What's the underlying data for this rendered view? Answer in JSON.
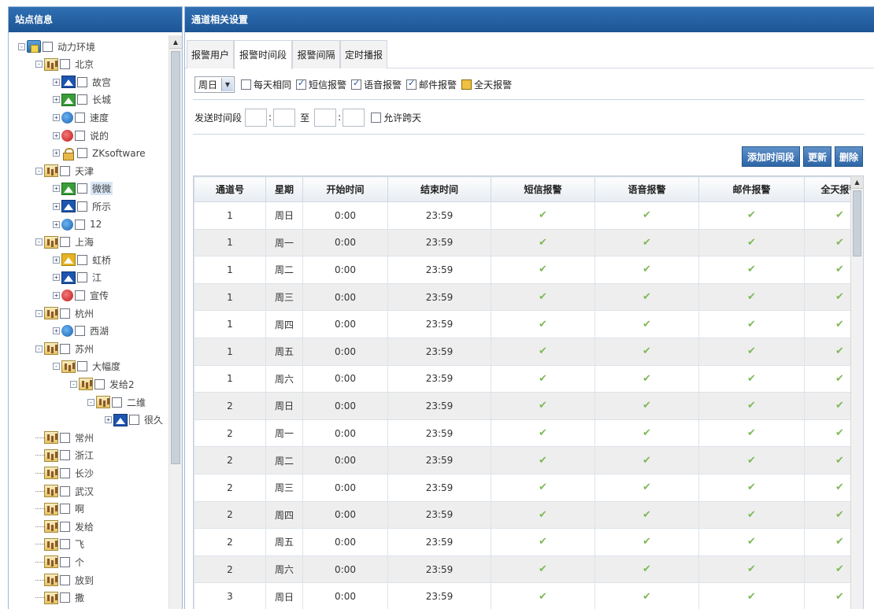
{
  "left_panel": {
    "title": "站点信息",
    "tree": [
      {
        "label": "动力环境",
        "icon": "house-icon",
        "type": "root"
      },
      {
        "label": "北京",
        "icon": "building-icon"
      },
      {
        "label": "故宫",
        "icon": "camera-blue-icon"
      },
      {
        "label": "长城",
        "icon": "camera-green-icon"
      },
      {
        "label": "速度",
        "icon": "circle-blue-icon"
      },
      {
        "label": "说的",
        "icon": "circle-red-icon"
      },
      {
        "label": "ZKsoftware",
        "icon": "lock-icon"
      },
      {
        "label": "天津",
        "icon": "building-icon"
      },
      {
        "label": "微微",
        "icon": "camera-green-icon",
        "selected": true
      },
      {
        "label": "所示",
        "icon": "camera-blue-icon"
      },
      {
        "label": "12",
        "icon": "circle-blue-icon"
      },
      {
        "label": "上海",
        "icon": "building-icon"
      },
      {
        "label": "虹桥",
        "icon": "camera-yellow-icon"
      },
      {
        "label": "江",
        "icon": "camera-blue-icon"
      },
      {
        "label": "宣传",
        "icon": "circle-red-icon"
      },
      {
        "label": "杭州",
        "icon": "building-icon"
      },
      {
        "label": "西湖",
        "icon": "circle-blue-icon"
      },
      {
        "label": "苏州",
        "icon": "building-icon"
      },
      {
        "label": "大幅度",
        "icon": "building-icon"
      },
      {
        "label": "发给2",
        "icon": "building-icon"
      },
      {
        "label": "二维",
        "icon": "building-icon"
      },
      {
        "label": "很久",
        "icon": "camera-blue-icon"
      },
      {
        "label": "常州",
        "icon": "building-icon"
      },
      {
        "label": "浙江",
        "icon": "building-icon"
      },
      {
        "label": "长沙",
        "icon": "building-icon"
      },
      {
        "label": "武汉",
        "icon": "building-icon"
      },
      {
        "label": "啊",
        "icon": "building-icon"
      },
      {
        "label": "发给",
        "icon": "building-icon"
      },
      {
        "label": "飞",
        "icon": "building-icon"
      },
      {
        "label": "个",
        "icon": "building-icon"
      },
      {
        "label": "放到",
        "icon": "building-icon"
      },
      {
        "label": "撒",
        "icon": "building-icon"
      }
    ]
  },
  "right_panel": {
    "title": "通道相关设置",
    "tabs": [
      {
        "label": "报警用户",
        "active": false
      },
      {
        "label": "报警时间段",
        "active": true
      },
      {
        "label": "报警间隔",
        "active": false
      },
      {
        "label": "定时播报",
        "active": false
      }
    ],
    "filter": {
      "weekday_selected": "周日",
      "same_every_day": {
        "label": "每天相同",
        "checked": false
      },
      "sms_alarm": {
        "label": "短信报警",
        "checked": true
      },
      "voice_alarm": {
        "label": "语音报警",
        "checked": true
      },
      "email_alarm": {
        "label": "邮件报警",
        "checked": true
      },
      "allday_alarm": {
        "label": "全天报警",
        "checked": false
      }
    },
    "time_range": {
      "label": "发送时间段",
      "separator_colon": ":",
      "to_label": "至",
      "cross_day": {
        "label": "允许跨天",
        "checked": false
      }
    },
    "buttons": {
      "add": "添加时间段",
      "update": "更新",
      "delete": "删除"
    },
    "table": {
      "headers": [
        "通道号",
        "星期",
        "开始时间",
        "结束时间",
        "短信报警",
        "语音报警",
        "邮件报警",
        "全天报警"
      ],
      "check_glyph": "✔",
      "rows": [
        {
          "channel": "1",
          "weekday": "周日",
          "start": "0:00",
          "end": "23:59"
        },
        {
          "channel": "1",
          "weekday": "周一",
          "start": "0:00",
          "end": "23:59"
        },
        {
          "channel": "1",
          "weekday": "周二",
          "start": "0:00",
          "end": "23:59"
        },
        {
          "channel": "1",
          "weekday": "周三",
          "start": "0:00",
          "end": "23:59"
        },
        {
          "channel": "1",
          "weekday": "周四",
          "start": "0:00",
          "end": "23:59"
        },
        {
          "channel": "1",
          "weekday": "周五",
          "start": "0:00",
          "end": "23:59"
        },
        {
          "channel": "1",
          "weekday": "周六",
          "start": "0:00",
          "end": "23:59"
        },
        {
          "channel": "2",
          "weekday": "周日",
          "start": "0:00",
          "end": "23:59"
        },
        {
          "channel": "2",
          "weekday": "周一",
          "start": "0:00",
          "end": "23:59"
        },
        {
          "channel": "2",
          "weekday": "周二",
          "start": "0:00",
          "end": "23:59"
        },
        {
          "channel": "2",
          "weekday": "周三",
          "start": "0:00",
          "end": "23:59"
        },
        {
          "channel": "2",
          "weekday": "周四",
          "start": "0:00",
          "end": "23:59"
        },
        {
          "channel": "2",
          "weekday": "周五",
          "start": "0:00",
          "end": "23:59"
        },
        {
          "channel": "2",
          "weekday": "周六",
          "start": "0:00",
          "end": "23:59"
        },
        {
          "channel": "3",
          "weekday": "周日",
          "start": "0:00",
          "end": "23:59"
        }
      ]
    }
  },
  "colors": {
    "header_bg": "#1d5596",
    "button_bg": "#2d65a6",
    "check_green": "#7fb95a",
    "row_alt": "#eeeeee"
  }
}
